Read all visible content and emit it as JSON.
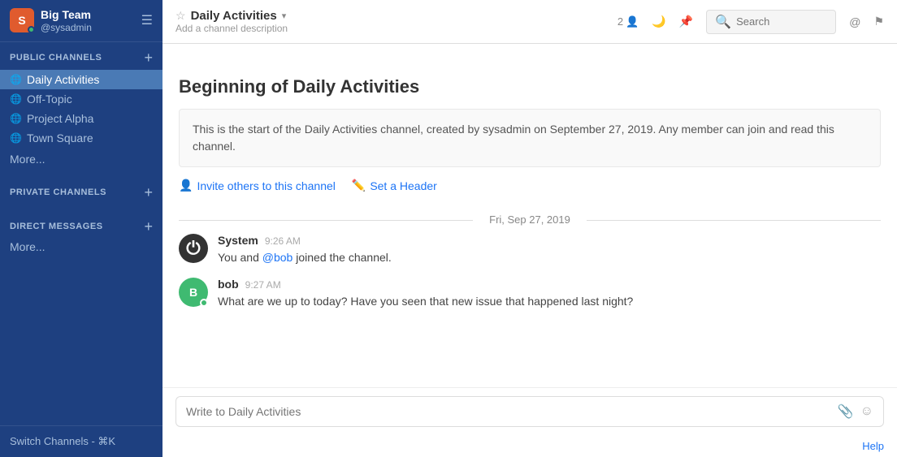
{
  "sidebar": {
    "team": {
      "name": "Big Team",
      "username": "@sysadmin",
      "avatar_initials": "S"
    },
    "public_channels_label": "PUBLIC CHANNELS",
    "public_channels": [
      {
        "name": "Daily Activities",
        "active": true
      },
      {
        "name": "Off-Topic",
        "active": false
      },
      {
        "name": "Project Alpha",
        "active": false
      },
      {
        "name": "Town Square",
        "active": false
      }
    ],
    "public_more": "More...",
    "private_channels_label": "PRIVATE CHANNELS",
    "direct_messages_label": "DIRECT MESSAGES",
    "direct_more": "More...",
    "switch_channels": "Switch Channels - ⌘K"
  },
  "channel": {
    "title": "Daily Activities",
    "description": "Add a channel description",
    "members_count": "2",
    "search_placeholder": "Search"
  },
  "chat": {
    "intro_heading": "Beginning of Daily Activities",
    "intro_text": "This is the start of the Daily Activities channel, created by sysadmin on September 27, 2019. Any member can join and read this channel.",
    "invite_link": "Invite others to this channel",
    "set_header_link": "Set a Header",
    "date_divider": "Fri, Sep 27, 2019",
    "messages": [
      {
        "author": "System",
        "time": "9:26 AM",
        "avatar_type": "system",
        "text_parts": [
          {
            "type": "text",
            "content": "You and "
          },
          {
            "type": "mention",
            "content": "@bob"
          },
          {
            "type": "text",
            "content": " joined the channel."
          }
        ]
      },
      {
        "author": "bob",
        "time": "9:27 AM",
        "avatar_type": "bob",
        "text": "What are we up to today?  Have you seen that new issue that happened last night?"
      }
    ],
    "input_placeholder": "Write to Daily Activities",
    "help_label": "Help"
  },
  "icons": {
    "star": "☆",
    "dropdown": "▾",
    "globe": "🌐",
    "search": "🔍",
    "at": "@",
    "flag": "⚑",
    "pin": "📌",
    "members": "👤",
    "attach": "📎",
    "emoji": "☺",
    "invite": "👤",
    "header": "✏️"
  }
}
